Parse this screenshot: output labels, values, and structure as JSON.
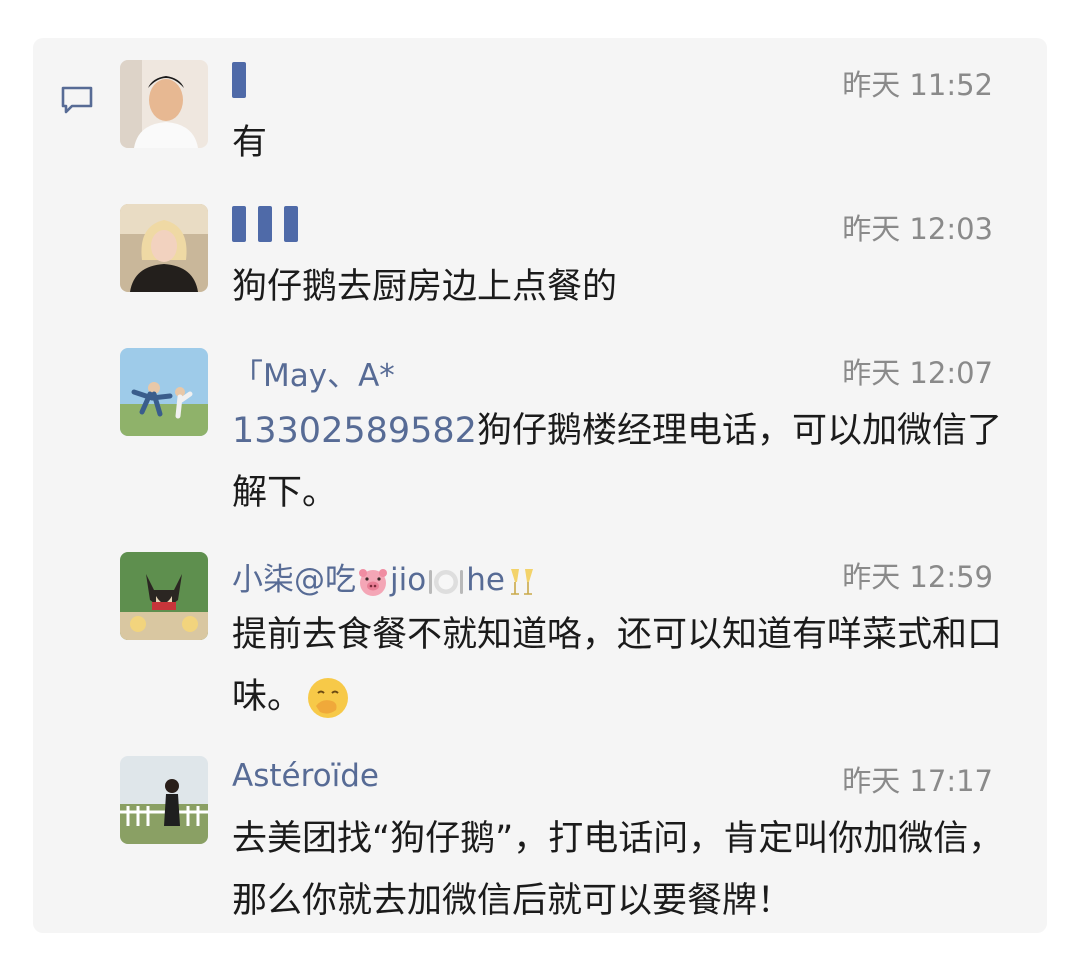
{
  "messages": [
    {
      "name": "",
      "time": "昨天 11:52",
      "text": "有"
    },
    {
      "name": "",
      "time": "昨天 12:03",
      "text": "狗仔鹅去厨房边上点餐的"
    },
    {
      "name": "「May、A*",
      "time": "昨天 12:07",
      "phone": "13302589582",
      "text": "狗仔鹅楼经理电话，可以加微信了解下。"
    },
    {
      "name_parts": [
        "小柒@吃",
        "jio",
        "he"
      ],
      "time": "昨天 12:59",
      "text": "提前去食餐不就知道咯，还可以知道有咩菜式和口味。",
      "emoji": "hand-over-mouth-emoji"
    },
    {
      "name": "Astéroïde",
      "time": "昨天 17:17",
      "text": "去美团找“狗仔鹅”，打电话问，肯定叫你加微信，那么你就去加微信后就可以要餐牌！"
    }
  ],
  "icons": {
    "side": "comment-icon",
    "name_emojis": [
      "pig-face-emoji",
      "fork-knife-plate-emoji",
      "clinking-glasses-emoji"
    ]
  },
  "colors": {
    "name": "#576b95",
    "phone": "#576b95",
    "time": "#8a8a8a",
    "text": "#1b1b1b",
    "panel": "#f5f5f5"
  }
}
